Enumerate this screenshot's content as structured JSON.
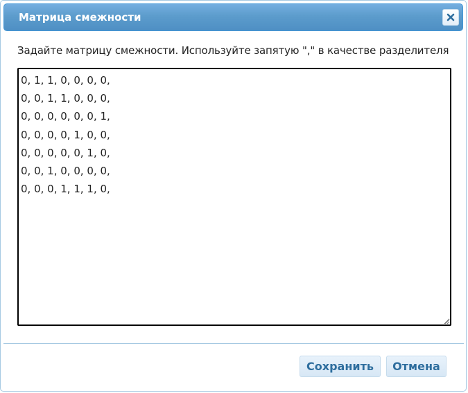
{
  "dialog": {
    "title": "Матрица смежности",
    "close_icon": "close-icon",
    "instruction": "Задайте матрицу смежности. Используйте запятую \",\" в качестве разделителя",
    "matrix_text": "0, 1, 1, 0, 0, 0, 0,\n0, 0, 1, 1, 0, 0, 0,\n0, 0, 0, 0, 0, 0, 1,\n0, 0, 0, 0, 1, 0, 0,\n0, 0, 0, 0, 0, 1, 0,\n0, 0, 1, 0, 0, 0, 0,\n0, 0, 0, 1, 1, 1, 0,",
    "buttons": {
      "save_label": "Сохранить",
      "cancel_label": "Отмена"
    }
  },
  "colors": {
    "titlebar": "#5c9ccc",
    "title_text": "#ffffff",
    "button_text": "#2e6e9e",
    "border": "#a6c9e2"
  }
}
